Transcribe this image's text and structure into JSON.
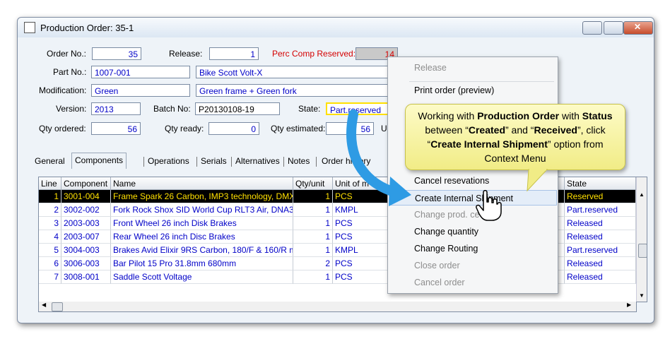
{
  "window": {
    "title": "Production Order: 35-1"
  },
  "header": {
    "order_no_label": "Order No.:",
    "order_no": "35",
    "release_label": "Release:",
    "release": "1",
    "perc_label": "Perc Comp Reserved:",
    "perc": "14",
    "part_no_label": "Part No.:",
    "part_no": "1007-001",
    "part_desc": "Bike Scott Volt-X",
    "modification_label": "Modification:",
    "modification": "Green",
    "modification_desc": "Green frame + Green fork",
    "version_label": "Version:",
    "version": "2013",
    "batch_label": "Batch No:",
    "batch": "P20130108-19",
    "state_label": "State:",
    "state": "Part.reserved",
    "qty_ordered_label": "Qty ordered:",
    "qty_ordered": "56",
    "qty_ready_label": "Qty ready:",
    "qty_ready": "0",
    "qty_estimated_label": "Qty estimated:",
    "qty_estimated": "56",
    "unit_label_partial": "U"
  },
  "tabs": [
    "General",
    "Components",
    "Operations",
    "Serials",
    "Alternatives",
    "Notes",
    "Order history"
  ],
  "grid": {
    "columns": [
      "Line",
      "Component",
      "Name",
      "Qty/unit",
      "Unit of m",
      "State"
    ],
    "rows": [
      {
        "line": "1",
        "component": "3001-004",
        "name": "Frame Spark 26 Carbon, IMP3 technology, DMX",
        "qty": "1",
        "unit": "PCS",
        "state": "Reserved",
        "selected": true
      },
      {
        "line": "2",
        "component": "3002-002",
        "name": "Fork Rock Shox SID World Cup RLT3 Air, DNA3",
        "qty": "1",
        "unit": "KMPL",
        "state": "Part.reserved"
      },
      {
        "line": "3",
        "component": "2003-003",
        "name": "Front Wheel 26 inch Disk Brakes",
        "qty": "1",
        "unit": "PCS",
        "state": "Released"
      },
      {
        "line": "4",
        "component": "2003-007",
        "name": "Rear Wheel 26 inch Disc Brakes",
        "qty": "1",
        "unit": "PCS",
        "state": "Released"
      },
      {
        "line": "5",
        "component": "3004-003",
        "name": "Brakes Avid Elixir 9RS Carbon, 180/F & 160/R m",
        "qty": "1",
        "unit": "KMPL",
        "state": "Part.reserved"
      },
      {
        "line": "6",
        "component": "3006-003",
        "name": "Bar Pilot 15 Pro 31.8mm 680mm",
        "qty": "2",
        "unit": "PCS",
        "state": "Released"
      },
      {
        "line": "7",
        "component": "3008-001",
        "name": "Saddle Scott Voltage",
        "qty": "1",
        "unit": "PCS",
        "state": "Released"
      }
    ]
  },
  "context_menu": {
    "items": [
      {
        "label": "Release",
        "disabled": true
      },
      {
        "label": "Print order (preview)",
        "disabled": false
      },
      {
        "label": "Cancel resevations",
        "disabled": false
      },
      {
        "label": "Create Internal Shipment",
        "disabled": false,
        "highlighted": true
      },
      {
        "label": "Change prod. ce",
        "disabled": true
      },
      {
        "label": "Change quantity",
        "disabled": false
      },
      {
        "label": "Change Routing",
        "disabled": false
      },
      {
        "label": "Close order",
        "disabled": true
      },
      {
        "label": "Cancel order",
        "disabled": true
      }
    ]
  },
  "callout": {
    "t1": "Working with ",
    "b1": "Production Order",
    "t2": " with ",
    "b2": "Status",
    "t3": " between “",
    "b3": "Created",
    "t4": "” and “",
    "b4": "Received",
    "t5": "”, click “",
    "b5": "Create Internal Shipment",
    "t6": "” option from Context Menu"
  },
  "colors": {
    "accent_blue": "#0000c8",
    "selection_text": "#ffe000",
    "required_label": "#d40000",
    "callout_bg": "#f6f3a2",
    "arrow_blue": "#2e9be4"
  }
}
